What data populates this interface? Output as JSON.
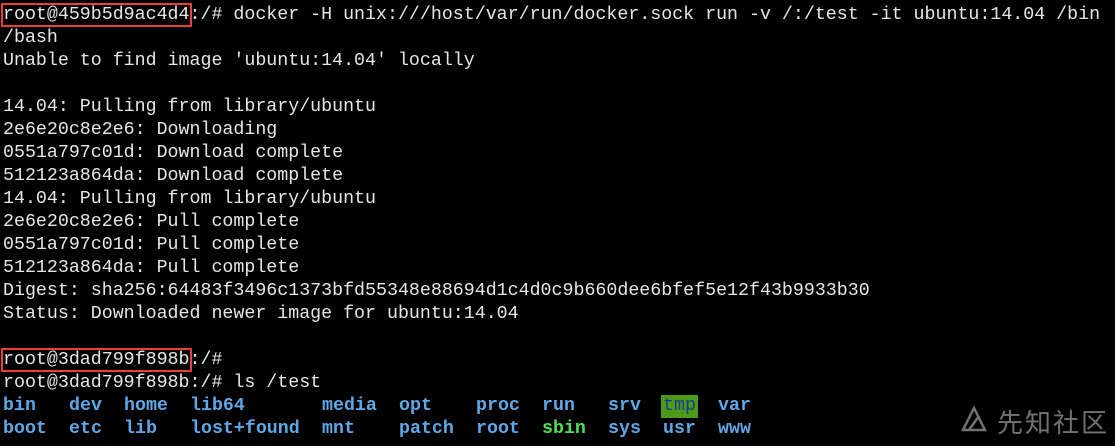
{
  "terminal": {
    "lines": [
      {
        "prompt": "root@459b5d9ac4d4",
        "text": ":/# docker -H unix:///host/var/run/docker.sock run -v /:/test -it ubuntu:14.04 /bin"
      },
      {
        "text": "/bash"
      },
      {
        "text": "Unable to find image 'ubuntu:14.04' locally"
      },
      {
        "text": ""
      },
      {
        "text": "14.04: Pulling from library/ubuntu"
      },
      {
        "text": "2e6e20c8e2e6: Downloading"
      },
      {
        "text": "0551a797c01d: Download complete"
      },
      {
        "text": "512123a864da: Download complete"
      },
      {
        "text": "14.04: Pulling from library/ubuntu"
      },
      {
        "text": "2e6e20c8e2e6: Pull complete"
      },
      {
        "text": "0551a797c01d: Pull complete"
      },
      {
        "text": "512123a864da: Pull complete"
      },
      {
        "text": "Digest: sha256:64483f3496c1373bfd55348e88694d1c4d0c9b660dee6bfef5e12f43b9933b30"
      },
      {
        "text": "Status: Downloaded newer image for ubuntu:14.04"
      },
      {
        "text": ""
      },
      {
        "prompt": "root@3dad799f898b",
        "text": ":/#"
      },
      {
        "text": "root@3dad799f898b:/# ls /test"
      }
    ],
    "ls_rows": [
      [
        {
          "name": "bin",
          "kind": "dir"
        },
        {
          "name": "dev",
          "kind": "dir"
        },
        {
          "name": "home",
          "kind": "dir"
        },
        {
          "name": "lib64",
          "kind": "dir"
        },
        {
          "name": "media",
          "kind": "dir"
        },
        {
          "name": "opt",
          "kind": "dir"
        },
        {
          "name": "proc",
          "kind": "dir"
        },
        {
          "name": "run",
          "kind": "dir"
        },
        {
          "name": "srv",
          "kind": "dir"
        },
        {
          "name": "tmp",
          "kind": "sticky"
        },
        {
          "name": "var",
          "kind": "dir"
        }
      ],
      [
        {
          "name": "boot",
          "kind": "dir"
        },
        {
          "name": "etc",
          "kind": "dir"
        },
        {
          "name": "lib",
          "kind": "dir"
        },
        {
          "name": "lost+found",
          "kind": "dir"
        },
        {
          "name": "mnt",
          "kind": "dir"
        },
        {
          "name": "patch",
          "kind": "dir"
        },
        {
          "name": "root",
          "kind": "dir"
        },
        {
          "name": "sbin",
          "kind": "exec"
        },
        {
          "name": "sys",
          "kind": "dir"
        },
        {
          "name": "usr",
          "kind": "dir"
        },
        {
          "name": "www",
          "kind": "dir"
        }
      ]
    ]
  },
  "colors": {
    "background": "#000000",
    "foreground": "#e6e6e6",
    "directory": "#5fa8e8",
    "executable_dir": "#4fe04f",
    "sticky_bg": "#4c9a1a",
    "highlight_box": "#e8413c"
  },
  "watermark": {
    "text": "先知社区",
    "icon": "xianzhi-logo-icon"
  }
}
